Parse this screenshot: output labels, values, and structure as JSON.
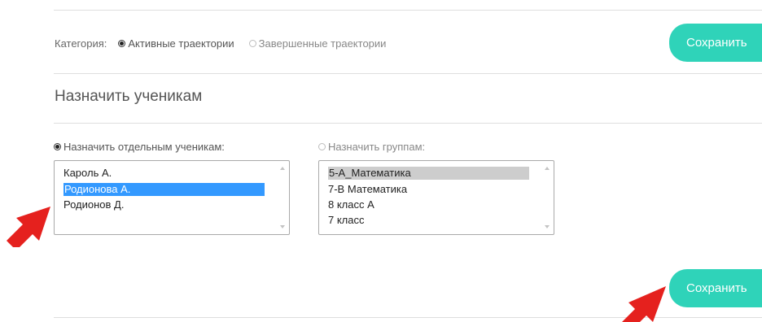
{
  "category": {
    "label": "Категория:",
    "options": [
      {
        "label": "Активные траектории",
        "selected": true
      },
      {
        "label": "Завершенные траектории",
        "selected": false
      }
    ],
    "save_label": "Сохранить"
  },
  "assign": {
    "title": "Назначить ученикам",
    "students": {
      "label": "Назначить отдельным ученикам:",
      "selected": true,
      "items": [
        "Кароль А.",
        "Родионова А.",
        "Родионов Д."
      ],
      "selected_item": "Родионова А."
    },
    "groups": {
      "label": "Назначить группам:",
      "selected": false,
      "items": [
        "5-А_Математика",
        "7-В Математика",
        "8 класс А",
        "7 класс"
      ],
      "highlighted_item": "5-А_Математика"
    },
    "save_label": "Сохранить"
  },
  "colors": {
    "accent": "#2fd3b9",
    "selection": "#3399ff",
    "arrow": "#e5211e"
  },
  "icons": [
    "radio-selected-icon",
    "radio-unselected-icon",
    "scroll-up-icon",
    "scroll-down-icon",
    "red-arrow-icon"
  ]
}
